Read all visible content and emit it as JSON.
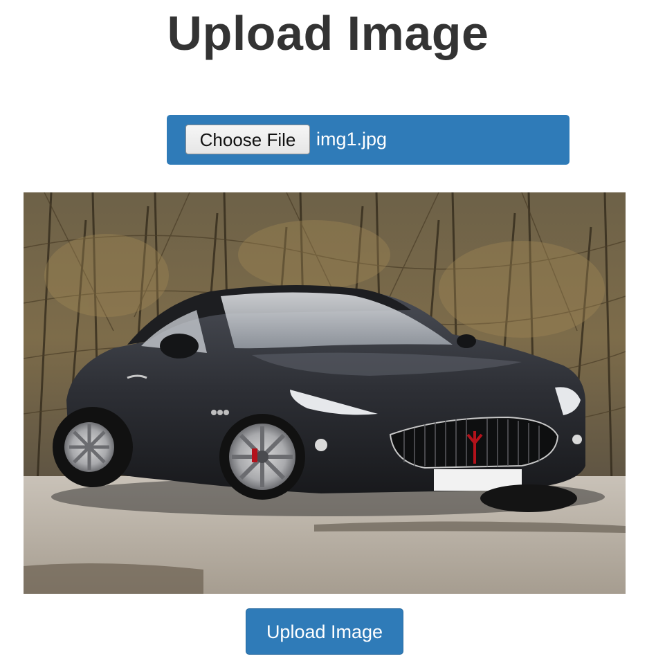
{
  "page": {
    "title": "Upload Image"
  },
  "file_input": {
    "button_label": "Choose File",
    "file_name": "img1.jpg"
  },
  "preview": {
    "alt": "img1.jpg preview"
  },
  "actions": {
    "upload_label": "Upload Image"
  },
  "colors": {
    "primary": "#2f7bb8",
    "title": "#333333"
  }
}
